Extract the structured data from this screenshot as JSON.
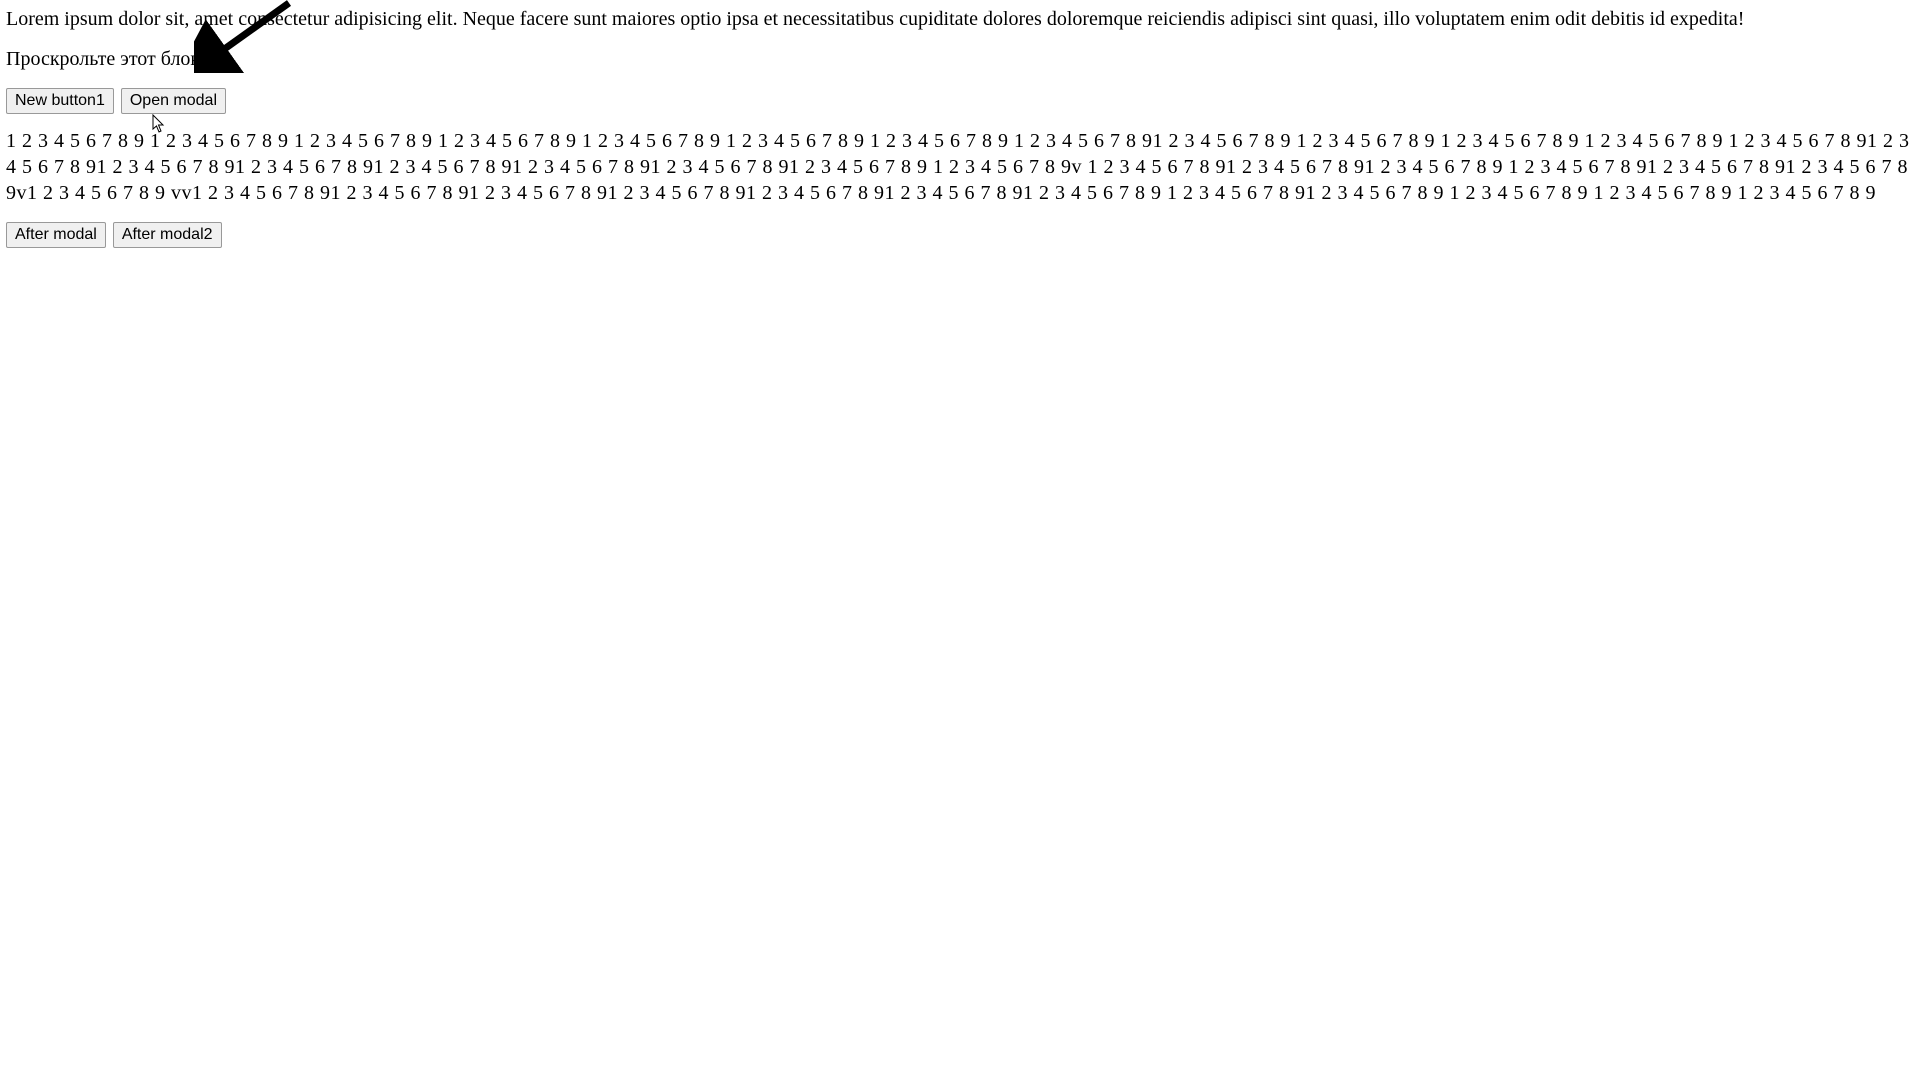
{
  "para1": "Lorem ipsum dolor sit, amet consectetur adipisicing elit. Neque facere sunt maiores optio ipsa et necessitatibus cupiditate dolores doloremque reiciendis adipisci sint quasi, illo voluptatem enim odit debitis id expedita!",
  "scroll_label": "Проскрольте этот блок",
  "buttons": {
    "new_button1": "New button1",
    "open_modal": "Open modal",
    "after_modal": "After modal",
    "after_modal2": "After modal2"
  },
  "numbers_text": "1 2 3 4 5 6 7 8 9 1 2 3 4 5 6 7 8 9 1 2 3 4 5 6 7 8 9 1 2 3 4 5 6 7 8 9 1 2 3 4 5 6 7 8 9 1 2 3 4 5 6 7 8 9 1 2 3 4 5 6 7 8 9 1 2 3 4 5 6 7 8 91 2 3 4 5 6 7 8 9 1 2 3 4 5 6 7 8 9 1 2 3 4 5 6 7 8 9 1 2 3 4 5 6 7 8 9 1 2 3 4 5 6 7 8 91 2 3 4 5 6 7 8 91 2 3 4 5 6 7 8 91 2 3 4 5 6 7 8 91 2 3 4 5 6 7 8 91 2 3 4 5 6 7 8 91 2 3 4 5 6 7 8 91 2 3 4 5 6 7 8 9 1 2 3 4 5 6 7 8 9v 1 2 3 4 5 6 7 8 91 2 3 4 5 6 7 8 91 2 3 4 5 6 7 8 9 1 2 3 4 5 6 7 8 91 2 3 4 5 6 7 8 91 2 3 4 5 6 7 8 9v1 2 3 4 5 6 7 8 9 vv1 2 3 4 5 6 7 8 91 2 3 4 5 6 7 8 91 2 3 4 5 6 7 8 91 2 3 4 5 6 7 8 91 2 3 4 5 6 7 8 91 2 3 4 5 6 7 8 91 2 3 4 5 6 7 8 9 1 2 3 4 5 6 7 8 91 2 3 4 5 6 7 8 9 1 2 3 4 5 6 7 8 9 1 2 3 4 5 6 7 8 9 1 2 3 4 5 6 7 8 9"
}
